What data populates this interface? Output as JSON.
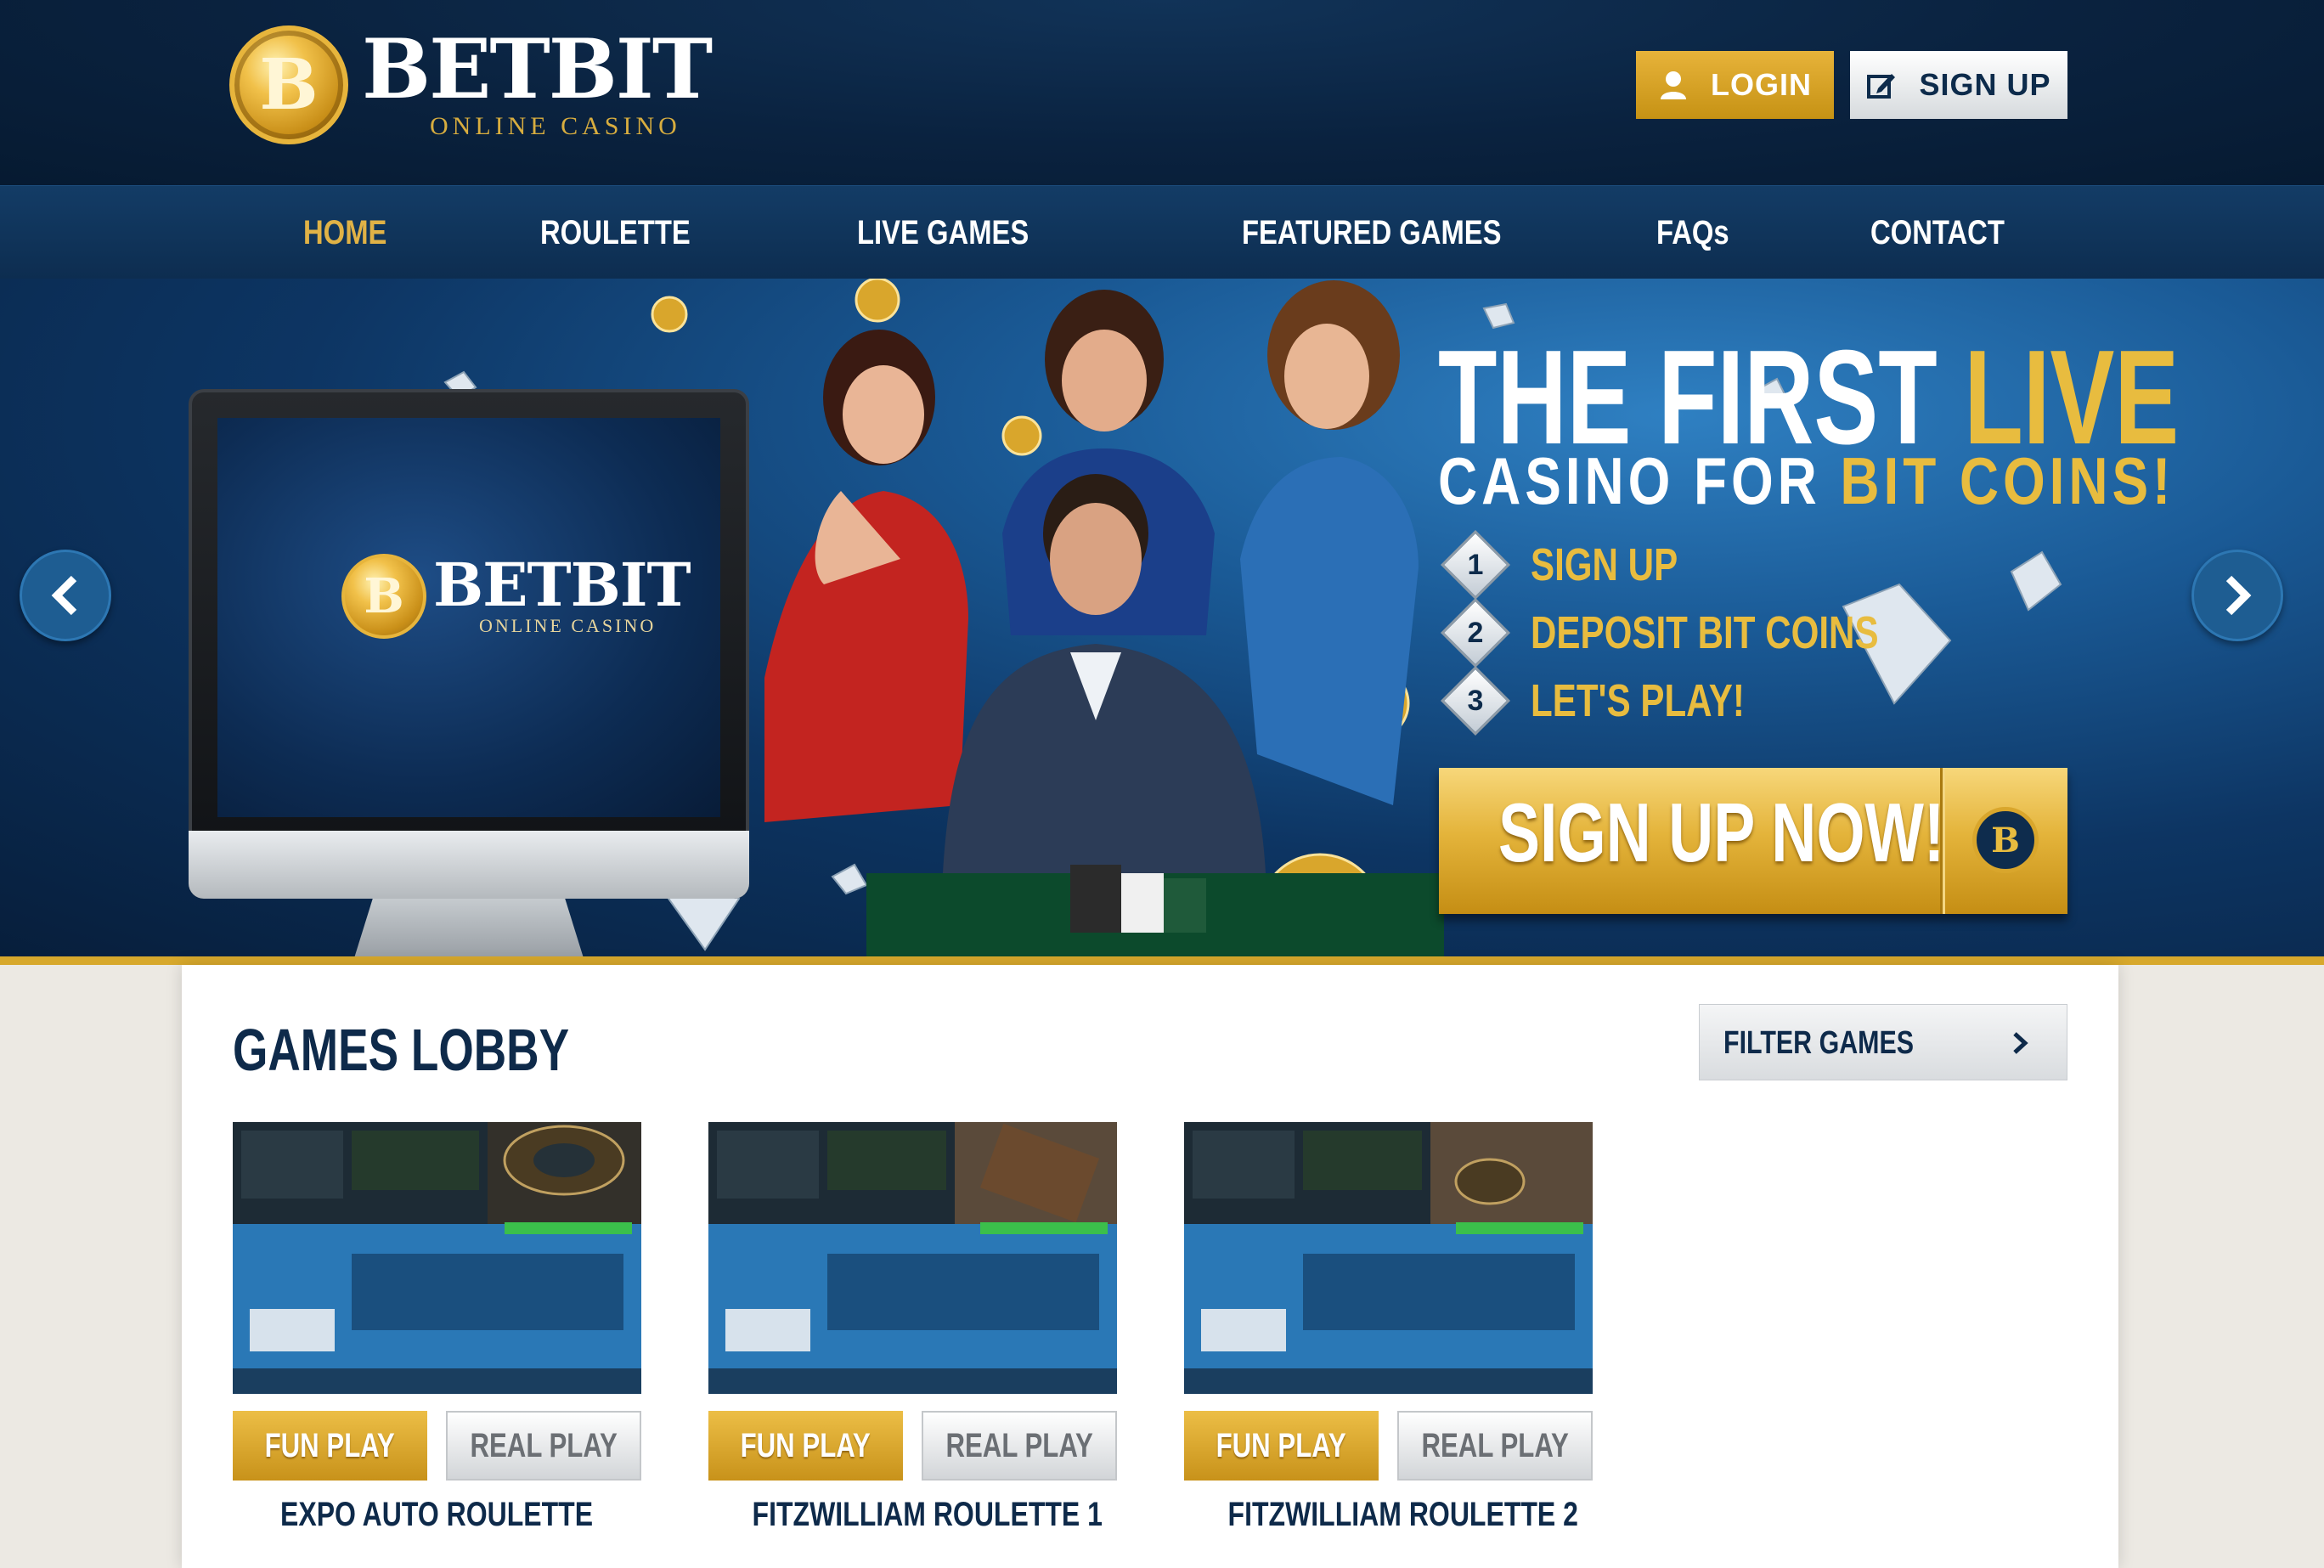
{
  "brand": {
    "name": "BETBIT",
    "tagline": "ONLINE CASINO",
    "coin_symbol": "B"
  },
  "header": {
    "login_label": "LOGIN",
    "signup_label": "SIGN UP"
  },
  "nav": {
    "items": [
      {
        "label": "HOME",
        "active": true
      },
      {
        "label": "ROULETTE",
        "active": false
      },
      {
        "label": "LIVE GAMES",
        "active": false
      },
      {
        "label": "FEATURED GAMES",
        "active": false
      },
      {
        "label": "FAQs",
        "active": false
      },
      {
        "label": "CONTACT",
        "active": false
      }
    ]
  },
  "hero": {
    "headline_white": "THE FIRST",
    "headline_gold": "LIVE",
    "subheadline_white": "CASINO FOR",
    "subheadline_gold": "BIT COINS!",
    "steps": [
      {
        "number": "1",
        "label": "SIGN UP"
      },
      {
        "number": "2",
        "label": "DEPOSIT BIT COINS"
      },
      {
        "number": "3",
        "label": "LET'S PLAY!"
      }
    ],
    "cta_label": "SIGN UP NOW!",
    "prev_arrow": "‹",
    "next_arrow": "›"
  },
  "lobby": {
    "title": "GAMES LOBBY",
    "filter_label": "FILTER GAMES",
    "games": [
      {
        "name": "EXPO AUTO ROULETTE",
        "fun_label": "FUN PLAY",
        "real_label": "REAL PLAY"
      },
      {
        "name": "FITZWILLIAM ROULETTE 1",
        "fun_label": "FUN PLAY",
        "real_label": "REAL PLAY"
      },
      {
        "name": "FITZWILLIAM ROULETTE 2",
        "fun_label": "FUN PLAY",
        "real_label": "REAL PLAY"
      }
    ]
  },
  "colors": {
    "navy": "#0a223f",
    "gold": "#e0b246",
    "accent_blue": "#1e5d92"
  }
}
